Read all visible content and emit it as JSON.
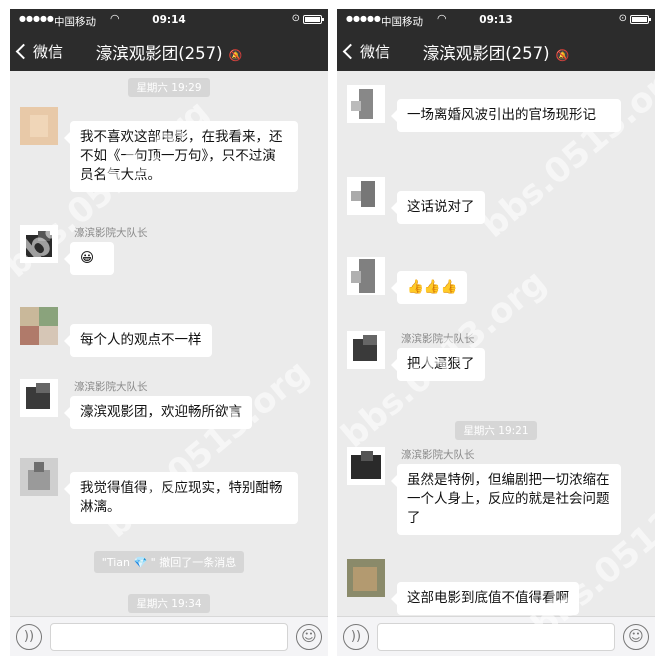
{
  "left_phone": {
    "status": {
      "carrier": "中国移动",
      "time": "09:14"
    },
    "nav": {
      "back_label": "微信",
      "title": "濠滨观影团(257)"
    },
    "timestamps": [
      "星期六 19:29",
      "星期六 19:34"
    ],
    "messages": [
      {
        "sender": "",
        "text": "我不喜欢这部电影，在我看来，还不如《一句顶一万句》，只不过演员名气大点。"
      },
      {
        "sender": "濠滨影院大队长",
        "text": "😀"
      },
      {
        "sender": "",
        "text": "每个人的观点不一样"
      },
      {
        "sender": "濠滨影院大队长",
        "text": "濠滨观影团，欢迎畅所欲言"
      },
      {
        "sender": "",
        "text": "我觉得值得，反应现实，特别酣畅淋漓。"
      }
    ],
    "recall_notice": "\"Tian 💎 \" 撤回了一条消息"
  },
  "right_phone": {
    "status": {
      "carrier": "中国移动",
      "time": "09:13"
    },
    "nav": {
      "back_label": "微信",
      "title": "濠滨观影团(257)"
    },
    "timestamps": [
      "星期六 19:21"
    ],
    "messages": [
      {
        "sender": "",
        "text": "一场离婚风波引出的官场现形记"
      },
      {
        "sender": "",
        "text": "这话说对了"
      },
      {
        "sender": "",
        "text": "👍👍👍"
      },
      {
        "sender": "濠滨影院大队长",
        "text": "把人逼狠了"
      },
      {
        "sender": "濠滨影院大队长",
        "text": "虽然是特例，但编剧把一切浓缩在一个人身上，反应的就是社会问题了"
      },
      {
        "sender": "",
        "text": "这部电影到底值不值得看啊"
      }
    ]
  },
  "watermark": "bbs.0513.org",
  "icons": [
    "back-chevron-icon",
    "wifi-icon",
    "battery-icon",
    "mute-icon",
    "voice-icon",
    "emoji-icon"
  ],
  "colors": {
    "navbar": "#2c2c2c",
    "chat_bg": "#ebebeb",
    "bubble": "#ffffff",
    "timestamp_bg": "#d6d6d6"
  }
}
